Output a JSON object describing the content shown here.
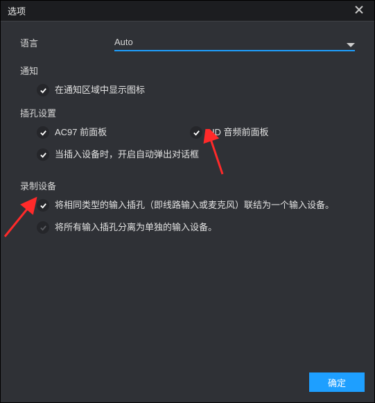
{
  "window": {
    "title": "选项"
  },
  "language": {
    "label": "语言",
    "selected": "Auto"
  },
  "notify": {
    "title": "通知",
    "opt_show_icon": {
      "label": "在通知区域中显示图标",
      "checked": true
    }
  },
  "jack": {
    "title": "插孔设置",
    "opt_ac97": {
      "label": "AC97 前面板",
      "checked": true
    },
    "opt_hd": {
      "label": "HD 音频前面板",
      "checked": true
    },
    "opt_popup": {
      "label": "当插入设备时，开启自动弹出对话框",
      "checked": true
    }
  },
  "record": {
    "title": "录制设备",
    "opt_merge": {
      "label": "将相同类型的输入插孔（即线路输入或麦克风）联结为一个输入设备。",
      "checked": true
    },
    "opt_split": {
      "label": "将所有输入插孔分离为单独的输入设备。",
      "checked": false
    }
  },
  "buttons": {
    "ok": "确定"
  }
}
